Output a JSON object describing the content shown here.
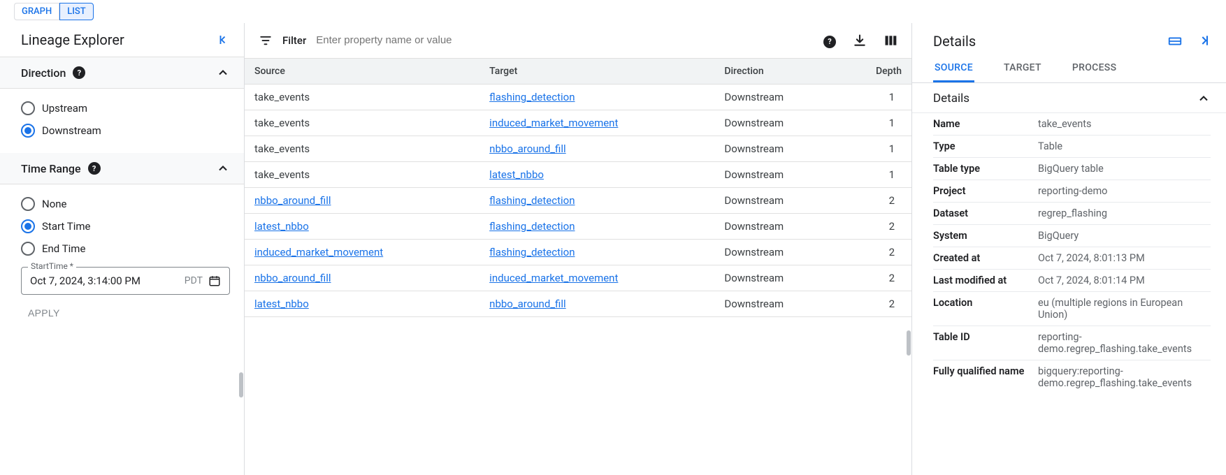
{
  "top_tabs": {
    "graph": "GRAPH",
    "list": "LIST"
  },
  "sidebar": {
    "title": "Lineage Explorer",
    "direction": {
      "header": "Direction",
      "options": {
        "upstream": "Upstream",
        "downstream": "Downstream"
      },
      "selected": "downstream"
    },
    "time_range": {
      "header": "Time Range",
      "options": {
        "none": "None",
        "start": "Start Time",
        "end": "End Time"
      },
      "selected": "start",
      "field_label": "StartTime *",
      "value": "Oct 7, 2024, 3:14:00 PM",
      "tz": "PDT"
    },
    "apply": "APPLY"
  },
  "filter": {
    "label": "Filter",
    "placeholder": "Enter property name or value"
  },
  "table": {
    "headers": {
      "source": "Source",
      "target": "Target",
      "direction": "Direction",
      "depth": "Depth"
    },
    "rows": [
      {
        "source": "take_events",
        "source_link": false,
        "target": "flashing_detection",
        "direction": "Downstream",
        "depth": "1"
      },
      {
        "source": "take_events",
        "source_link": false,
        "target": "induced_market_movement",
        "direction": "Downstream",
        "depth": "1"
      },
      {
        "source": "take_events",
        "source_link": false,
        "target": "nbbo_around_fill",
        "direction": "Downstream",
        "depth": "1"
      },
      {
        "source": "take_events",
        "source_link": false,
        "target": "latest_nbbo",
        "direction": "Downstream",
        "depth": "1"
      },
      {
        "source": "nbbo_around_fill",
        "source_link": true,
        "target": "flashing_detection",
        "direction": "Downstream",
        "depth": "2"
      },
      {
        "source": "latest_nbbo",
        "source_link": true,
        "target": "flashing_detection",
        "direction": "Downstream",
        "depth": "2"
      },
      {
        "source": "induced_market_movement",
        "source_link": true,
        "target": "flashing_detection",
        "direction": "Downstream",
        "depth": "2"
      },
      {
        "source": "nbbo_around_fill",
        "source_link": true,
        "target": "induced_market_movement",
        "direction": "Downstream",
        "depth": "2"
      },
      {
        "source": "latest_nbbo",
        "source_link": true,
        "target": "nbbo_around_fill",
        "direction": "Downstream",
        "depth": "2"
      }
    ]
  },
  "details": {
    "title": "Details",
    "tabs": {
      "source": "SOURCE",
      "target": "TARGET",
      "process": "PROCESS"
    },
    "sub": "Details",
    "kv": [
      {
        "k": "Name",
        "v": "take_events"
      },
      {
        "k": "Type",
        "v": "Table"
      },
      {
        "k": "Table type",
        "v": "BigQuery table"
      },
      {
        "k": "Project",
        "v": "reporting-demo"
      },
      {
        "k": "Dataset",
        "v": "regrep_flashing"
      },
      {
        "k": "System",
        "v": "BigQuery"
      },
      {
        "k": "Created at",
        "v": "Oct 7, 2024, 8:01:13 PM"
      },
      {
        "k": "Last modified at",
        "v": "Oct 7, 2024, 8:01:14 PM"
      },
      {
        "k": "Location",
        "v": "eu (multiple regions in European Union)"
      },
      {
        "k": "Table ID",
        "v": "reporting-demo.regrep_flashing.take_events"
      },
      {
        "k": "Fully qualified name",
        "v": "bigquery:reporting-demo.regrep_flashing.take_events"
      }
    ]
  }
}
